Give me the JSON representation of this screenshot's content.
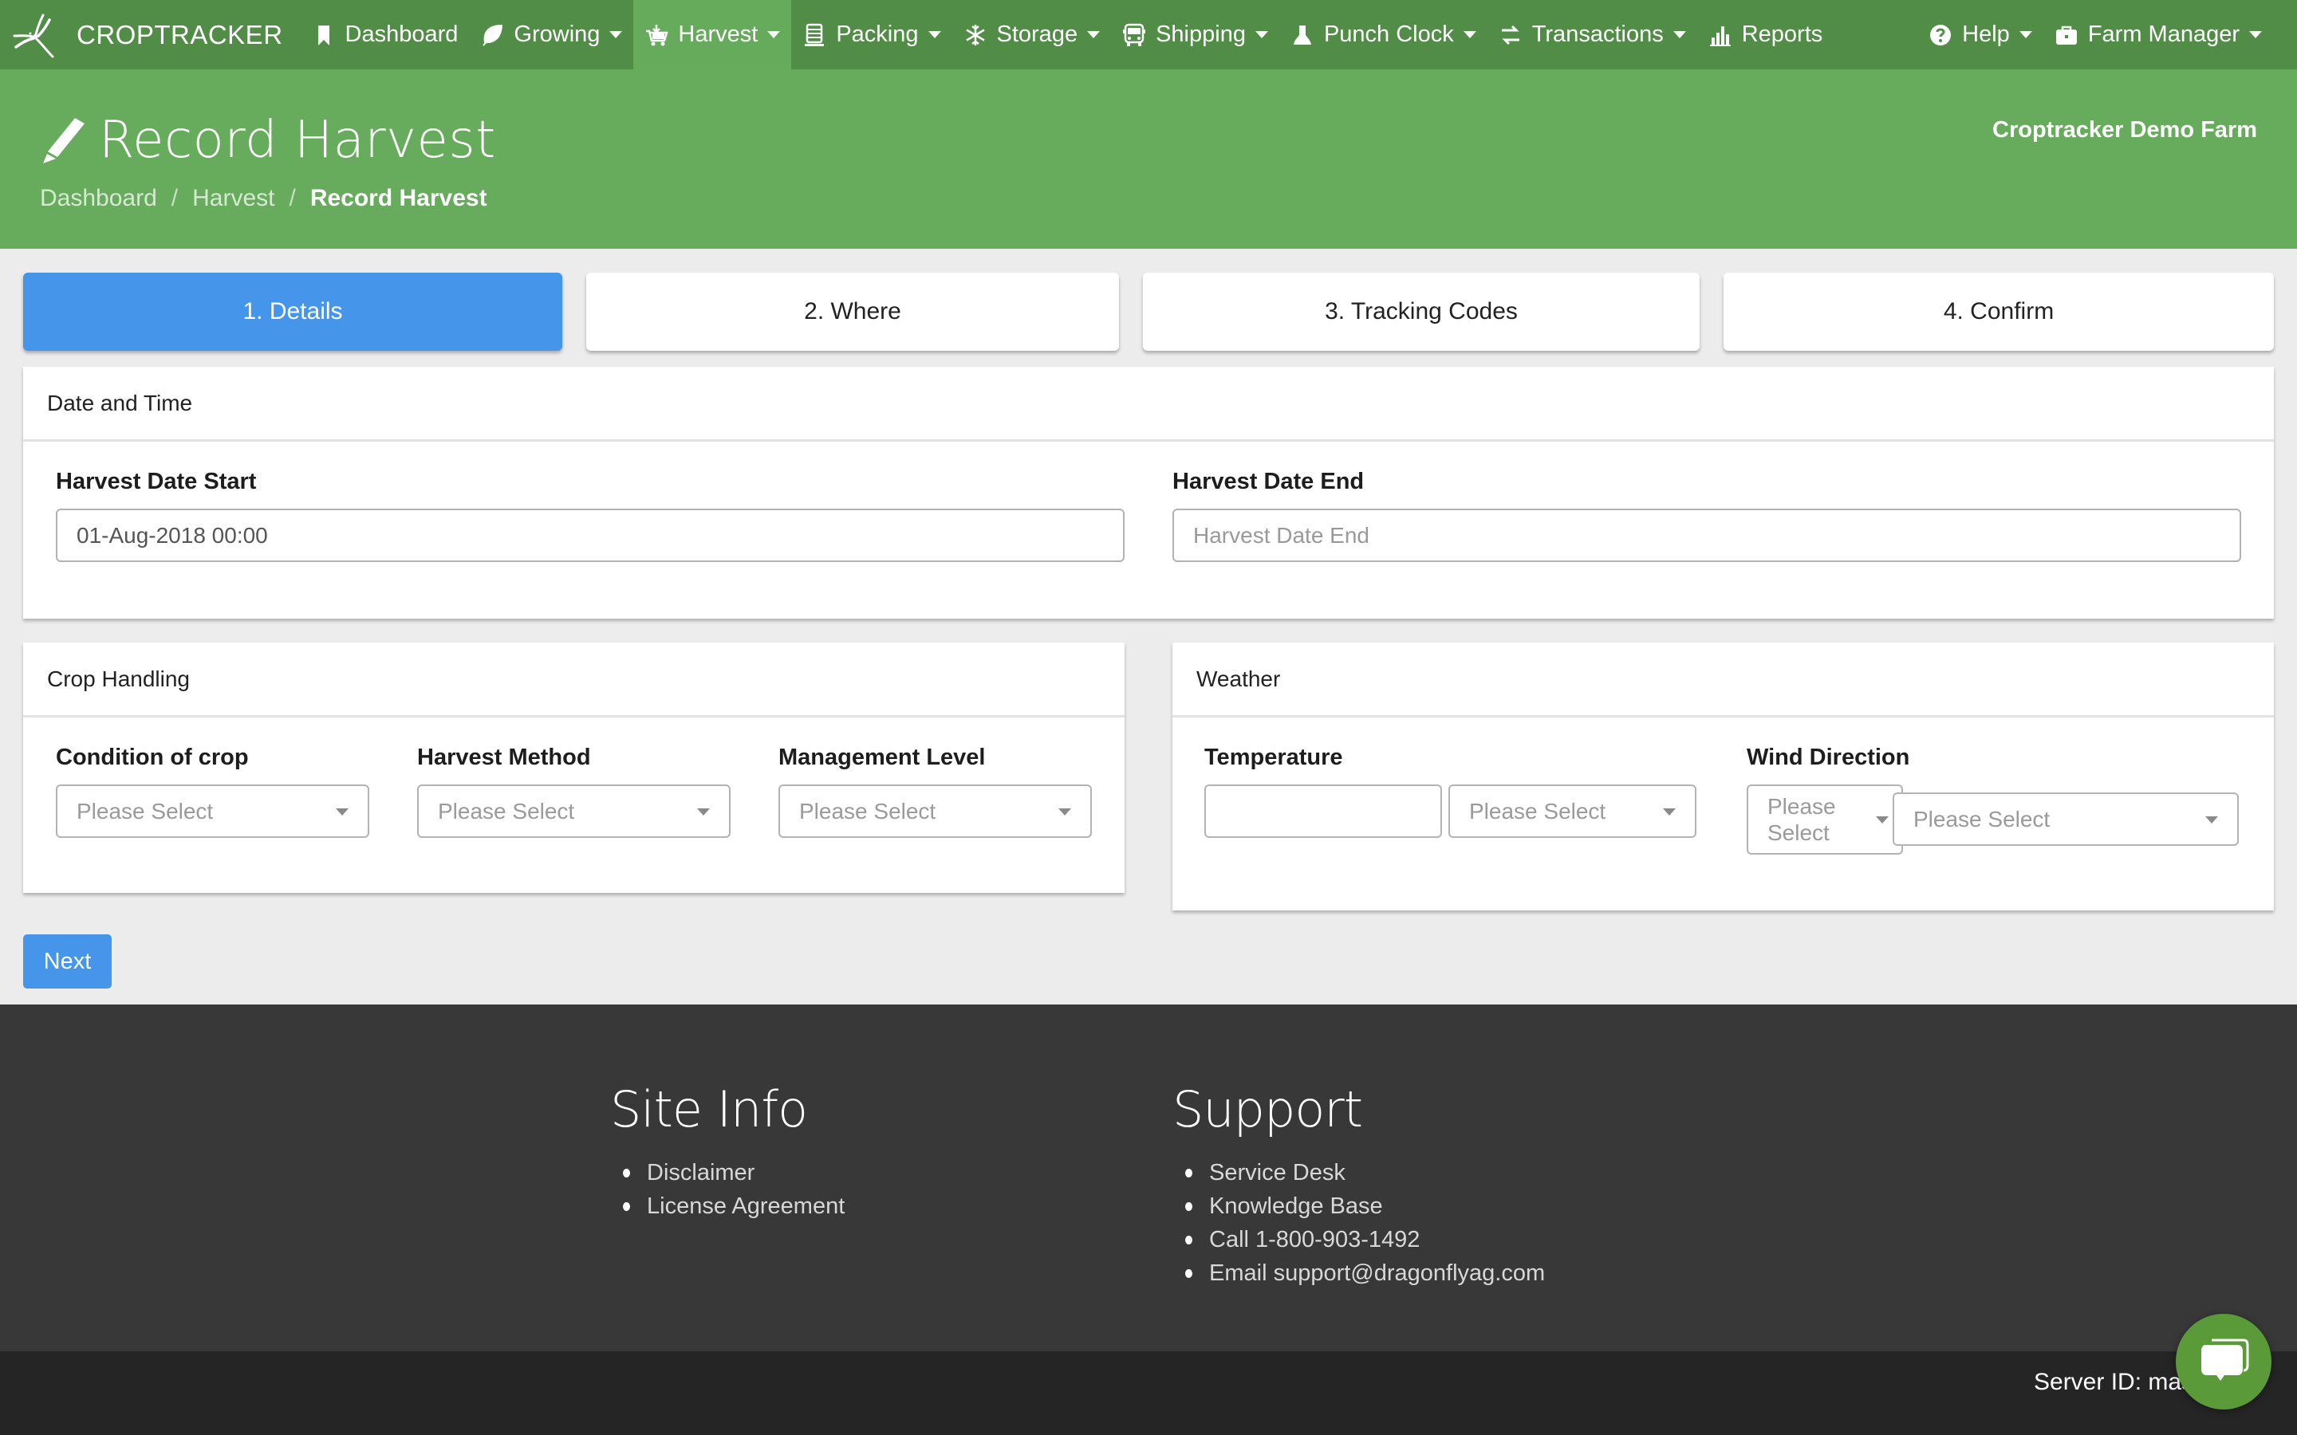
{
  "navbar": {
    "brand": "CROPTRACKER",
    "items": [
      {
        "label": "Dashboard",
        "icon": "bookmark-icon",
        "dropdown": false,
        "active": false
      },
      {
        "label": "Growing",
        "icon": "leaf-icon",
        "dropdown": true,
        "active": false
      },
      {
        "label": "Harvest",
        "icon": "harvest-basket-icon",
        "dropdown": true,
        "active": true
      },
      {
        "label": "Packing",
        "icon": "pallet-icon",
        "dropdown": true,
        "active": false
      },
      {
        "label": "Storage",
        "icon": "snowflake-icon",
        "dropdown": true,
        "active": false
      },
      {
        "label": "Shipping",
        "icon": "truck-icon",
        "dropdown": true,
        "active": false
      },
      {
        "label": "Punch Clock",
        "icon": "person-icon",
        "dropdown": true,
        "active": false
      },
      {
        "label": "Transactions",
        "icon": "exchange-icon",
        "dropdown": true,
        "active": false
      },
      {
        "label": "Reports",
        "icon": "bar-chart-icon",
        "dropdown": false,
        "active": false
      }
    ],
    "right_items": [
      {
        "label": "Help",
        "icon": "question-circle-icon",
        "dropdown": true
      },
      {
        "label": "Farm Manager",
        "icon": "briefcase-icon",
        "dropdown": true
      }
    ]
  },
  "header": {
    "title": "Record Harvest",
    "title_icon": "pencil-icon",
    "breadcrumb": [
      "Dashboard",
      "Harvest",
      "Record Harvest"
    ],
    "farm_name": "Croptracker Demo Farm"
  },
  "steps": [
    {
      "label": "1. Details",
      "active": true
    },
    {
      "label": "2. Where",
      "active": false
    },
    {
      "label": "3. Tracking Codes",
      "active": false
    },
    {
      "label": "4. Confirm",
      "active": false
    }
  ],
  "date_time": {
    "title": "Date and Time",
    "start_label": "Harvest Date Start",
    "start_value": "01-Aug-2018 00:00",
    "end_label": "Harvest Date End",
    "end_value": "",
    "end_placeholder": "Harvest Date End"
  },
  "crop_handling": {
    "title": "Crop Handling",
    "fields": [
      {
        "label": "Condition of crop",
        "value": "Please Select"
      },
      {
        "label": "Harvest Method",
        "value": "Please Select"
      },
      {
        "label": "Management Level",
        "value": "Please Select"
      }
    ]
  },
  "weather": {
    "title": "Weather",
    "temperature_label": "Temperature",
    "temperature_value": "",
    "temperature_unit": "Please Select",
    "wind_label": "Wind Direction",
    "wind_direction": "Please Select",
    "wind_speed": "Please Select"
  },
  "actions": {
    "next_label": "Next"
  },
  "footer": {
    "site_info_title": "Site Info",
    "site_info_links": [
      "Disclaimer",
      "License Agreement"
    ],
    "support_title": "Support",
    "support_links": [
      "Service Desk",
      "Knowledge Base",
      "Call 1-800-903-1492",
      "Email support@dragonflyag.com"
    ],
    "server_id": "Server ID: mas"
  },
  "colors": {
    "navbar": "#518d47",
    "navbar_active": "#66ab5b",
    "header": "#67ab5c",
    "primary": "#4595ea",
    "footer": "#383838",
    "bottom_bar": "#252525",
    "chat": "#5a9a38"
  }
}
